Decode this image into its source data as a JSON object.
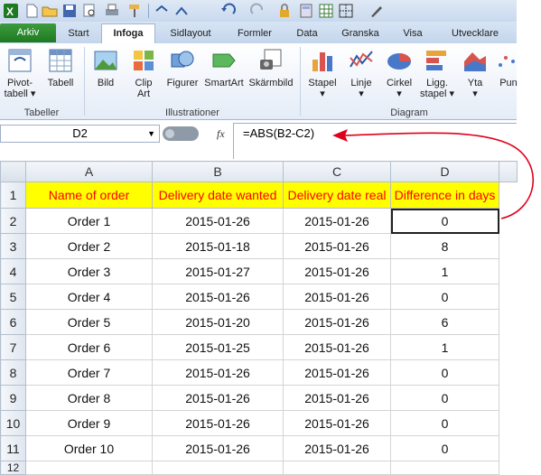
{
  "quick_access": {
    "icons": [
      "excel-icon",
      "new-doc-icon",
      "open-icon",
      "save-icon",
      "print-preview-icon",
      "print-icon",
      "format-painter-icon",
      "redo-icon",
      "undo-icon",
      "lock-icon",
      "calculator-icon",
      "table-icon",
      "borders-icon",
      "pen-icon"
    ]
  },
  "tabs": {
    "file": "Arkiv",
    "items": [
      "Start",
      "Infoga",
      "Sidlayout",
      "Formler",
      "Data",
      "Granska",
      "Visa",
      "Utvecklare"
    ],
    "active": "Infoga"
  },
  "ribbon": {
    "groups": [
      {
        "label": "Tabeller",
        "buttons": [
          {
            "label": "Pivot-\ntabell ▾",
            "icon": "pivot-table-icon"
          },
          {
            "label": "Tabell",
            "icon": "table-grid-icon"
          }
        ]
      },
      {
        "label": "Illustrationer",
        "buttons": [
          {
            "label": "Bild",
            "icon": "picture-icon"
          },
          {
            "label": "Clip\nArt",
            "icon": "clip-art-icon"
          },
          {
            "label": "Figurer",
            "icon": "shapes-icon"
          },
          {
            "label": "SmartArt",
            "icon": "smartart-icon"
          },
          {
            "label": "Skärmbild",
            "icon": "screenshot-icon"
          }
        ]
      },
      {
        "label": "Diagram",
        "buttons": [
          {
            "label": "Stapel",
            "icon": "column-chart-icon"
          },
          {
            "label": "Linje",
            "icon": "line-chart-icon"
          },
          {
            "label": "Cirkel",
            "icon": "pie-chart-icon"
          },
          {
            "label": "Ligg.\nstapel",
            "icon": "bar-chart-icon"
          },
          {
            "label": "Yta",
            "icon": "area-chart-icon"
          },
          {
            "label": "Pun",
            "icon": "scatter-chart-icon"
          }
        ]
      }
    ]
  },
  "formula_bar": {
    "name_box": "D2",
    "fx": "fx",
    "formula": "=ABS(B2-C2)"
  },
  "sheet": {
    "columns": [
      "A",
      "B",
      "C",
      "D"
    ],
    "headers": [
      "Name of order",
      "Delivery date wanted",
      "Delivery date real",
      "Difference in days"
    ],
    "rows": [
      {
        "num": "2",
        "cells": [
          "Order 1",
          "2015-01-26",
          "2015-01-26",
          "0"
        ]
      },
      {
        "num": "3",
        "cells": [
          "Order 2",
          "2015-01-18",
          "2015-01-26",
          "8"
        ]
      },
      {
        "num": "4",
        "cells": [
          "Order 3",
          "2015-01-27",
          "2015-01-26",
          "1"
        ]
      },
      {
        "num": "5",
        "cells": [
          "Order 4",
          "2015-01-26",
          "2015-01-26",
          "0"
        ]
      },
      {
        "num": "6",
        "cells": [
          "Order 5",
          "2015-01-20",
          "2015-01-26",
          "6"
        ]
      },
      {
        "num": "7",
        "cells": [
          "Order 6",
          "2015-01-25",
          "2015-01-26",
          "1"
        ]
      },
      {
        "num": "8",
        "cells": [
          "Order 7",
          "2015-01-26",
          "2015-01-26",
          "0"
        ]
      },
      {
        "num": "9",
        "cells": [
          "Order 8",
          "2015-01-26",
          "2015-01-26",
          "0"
        ]
      },
      {
        "num": "10",
        "cells": [
          "Order 9",
          "2015-01-26",
          "2015-01-26",
          "0"
        ]
      },
      {
        "num": "11",
        "cells": [
          "Order 10",
          "2015-01-26",
          "2015-01-26",
          "0"
        ]
      }
    ],
    "header_row_num": "1",
    "extra_row_num": "12",
    "selected_cell": "D2"
  },
  "colors": {
    "header_fill": "#ffff00",
    "header_text": "#ff0000",
    "annotation": "#e0001a",
    "file_tab": "#2a8a2d"
  }
}
